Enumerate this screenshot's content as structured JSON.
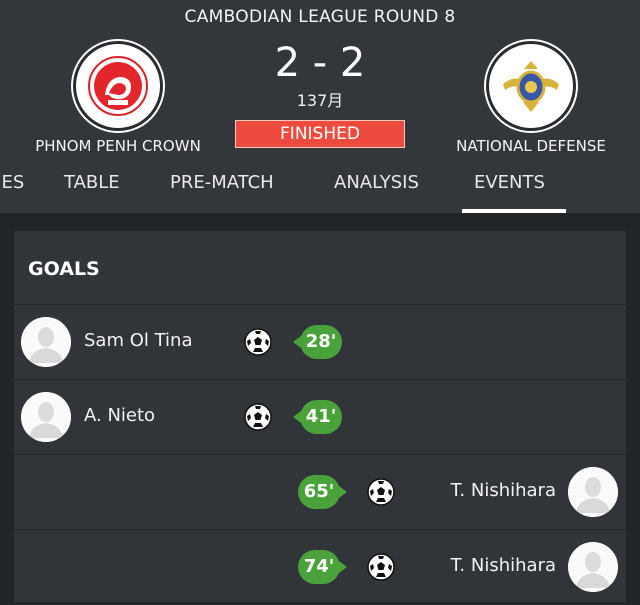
{
  "match": {
    "league_round": "CAMBODIAN LEAGUE ROUND 8",
    "score": "2 - 2",
    "minute": "137月",
    "status": "FINISHED",
    "home_team": "PHNOM PENH CROWN",
    "away_team": "NATIONAL DEFENSE"
  },
  "tabs": [
    {
      "label": "HES"
    },
    {
      "label": "TABLE"
    },
    {
      "label": "PRE-MATCH"
    },
    {
      "label": "ANALYSIS"
    },
    {
      "label": "EVENTS",
      "active": true
    }
  ],
  "goals": {
    "title": "GOALS",
    "events": [
      {
        "side": "home",
        "player": "Sam Ol Tina",
        "minute": "28'"
      },
      {
        "side": "home",
        "player": "A. Nieto",
        "minute": "41'"
      },
      {
        "side": "away",
        "player": "T. Nishihara",
        "minute": "65'"
      },
      {
        "side": "away",
        "player": "T. Nishihara",
        "minute": "74'"
      }
    ]
  },
  "colors": {
    "header_bg": "#33373b",
    "page_bg": "#222528",
    "status_red": "#ee4b3f",
    "goal_green": "#4aa33a"
  },
  "icons": {
    "home_crest": "phnom-penh-crown-crest-icon",
    "away_crest": "national-defense-crest-icon",
    "goal": "soccer-ball-icon",
    "player": "player-avatar-icon"
  }
}
